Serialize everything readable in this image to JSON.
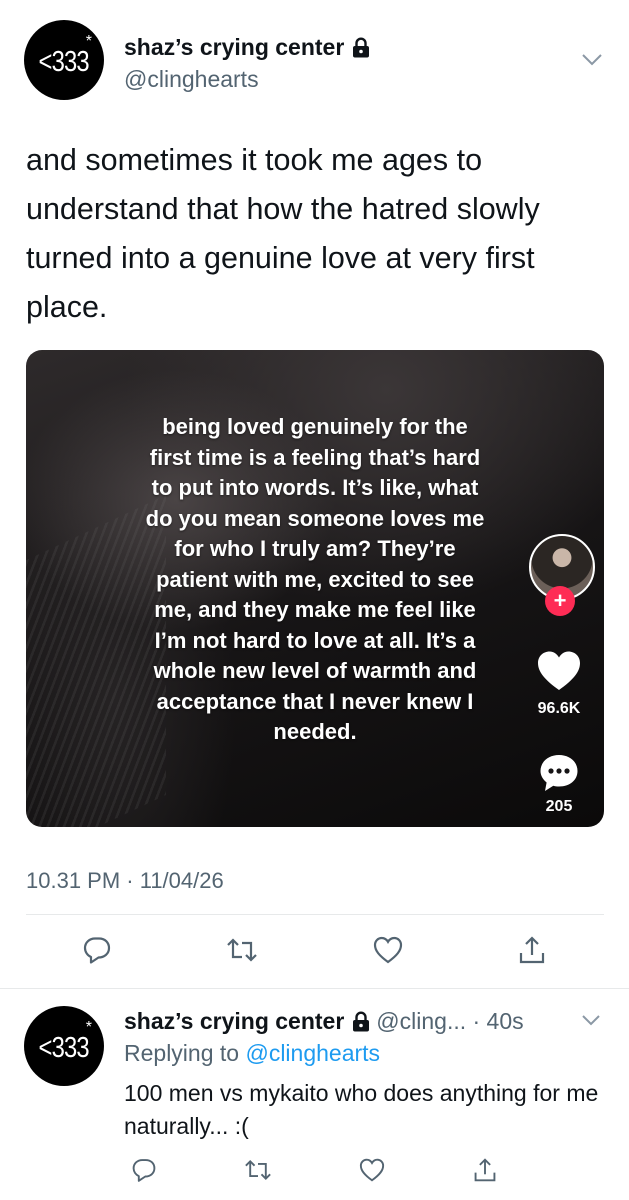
{
  "tweet": {
    "avatar_text": "<333",
    "avatar_star": "*",
    "display_name": "shaz’s crying center",
    "handle": "@clinghearts",
    "text": "and sometimes it took me ages to understand that how the hatred slowly turned into a genuine love at very first place.",
    "timestamp": "10.31 PM · 11/04/26"
  },
  "media": {
    "overlay_text": "being loved genuinely for the first time is a feeling that’s hard to put into words. It’s like, what do you mean someone loves me for who I truly am? They’re patient with me, excited to see me, and they make me feel like I’m not hard to love at all. It’s a whole new level of warmth and acceptance that I never knew I needed.",
    "follow_symbol": "+",
    "like_count": "96.6K",
    "comment_count": "205"
  },
  "reply": {
    "avatar_text": "<333",
    "avatar_star": "*",
    "display_name": "shaz’s crying center",
    "handle_time": "@cling... · 40s",
    "replying_prefix": "Replying to ",
    "replying_mention": "@clinghearts",
    "text": "100 men vs mykaito who does anything for me naturally... :("
  },
  "icons": [
    "lock-icon",
    "chevron-down-icon",
    "comment-icon",
    "retweet-icon",
    "heart-icon",
    "share-icon",
    "tiktok-heart-icon",
    "tiktok-comment-icon"
  ],
  "colors": {
    "text": "#0f1419",
    "secondary": "#536471",
    "link": "#1d9bf0",
    "tiktok_red": "#fe2c55",
    "divider": "#e7e9ea"
  }
}
